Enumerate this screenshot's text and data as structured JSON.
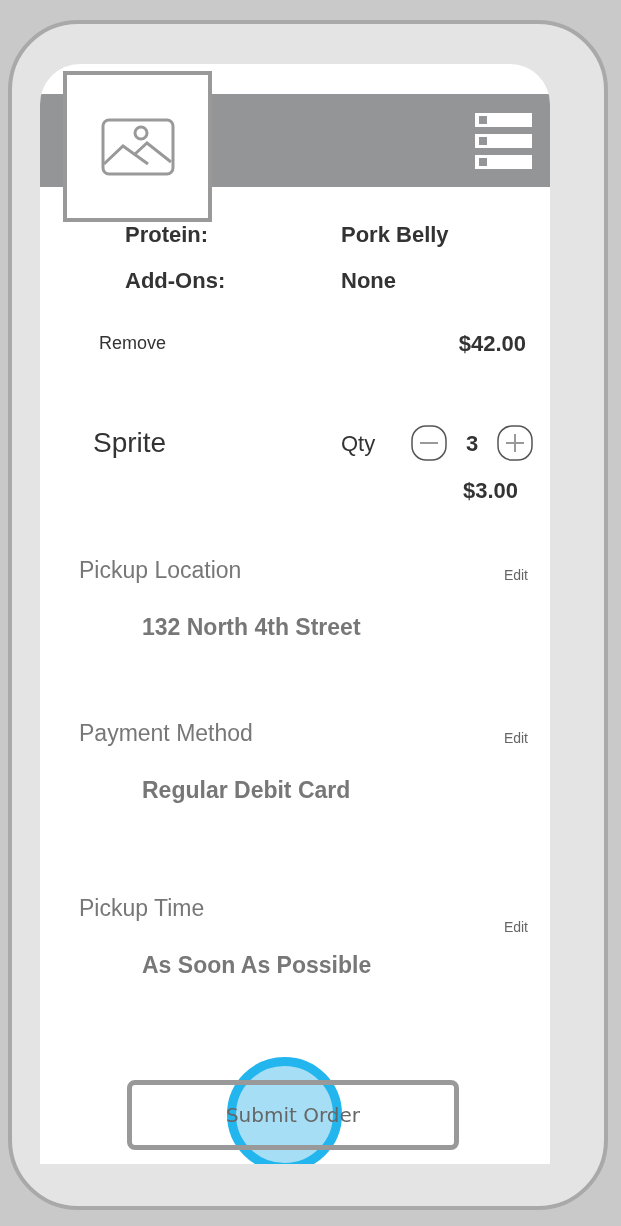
{
  "order_item": {
    "details": [
      {
        "label": "Protein:",
        "value": "Pork Belly"
      },
      {
        "label": "Add-Ons:",
        "value": "None"
      }
    ],
    "remove": "Remove",
    "price": "$42.00"
  },
  "drink": {
    "name": "Sprite",
    "qty_label": "Qty",
    "quantity": "3",
    "price": "$3.00"
  },
  "sections": [
    {
      "title": "Pickup Location",
      "edit": "Edit",
      "value": "132 North 4th Street"
    },
    {
      "title": "Payment Method",
      "edit": "Edit",
      "value": "Regular Debit Card"
    },
    {
      "title": "Pickup Time",
      "edit": "Edit",
      "value": "As Soon As Possible"
    }
  ],
  "submit_button": "Submit Order"
}
